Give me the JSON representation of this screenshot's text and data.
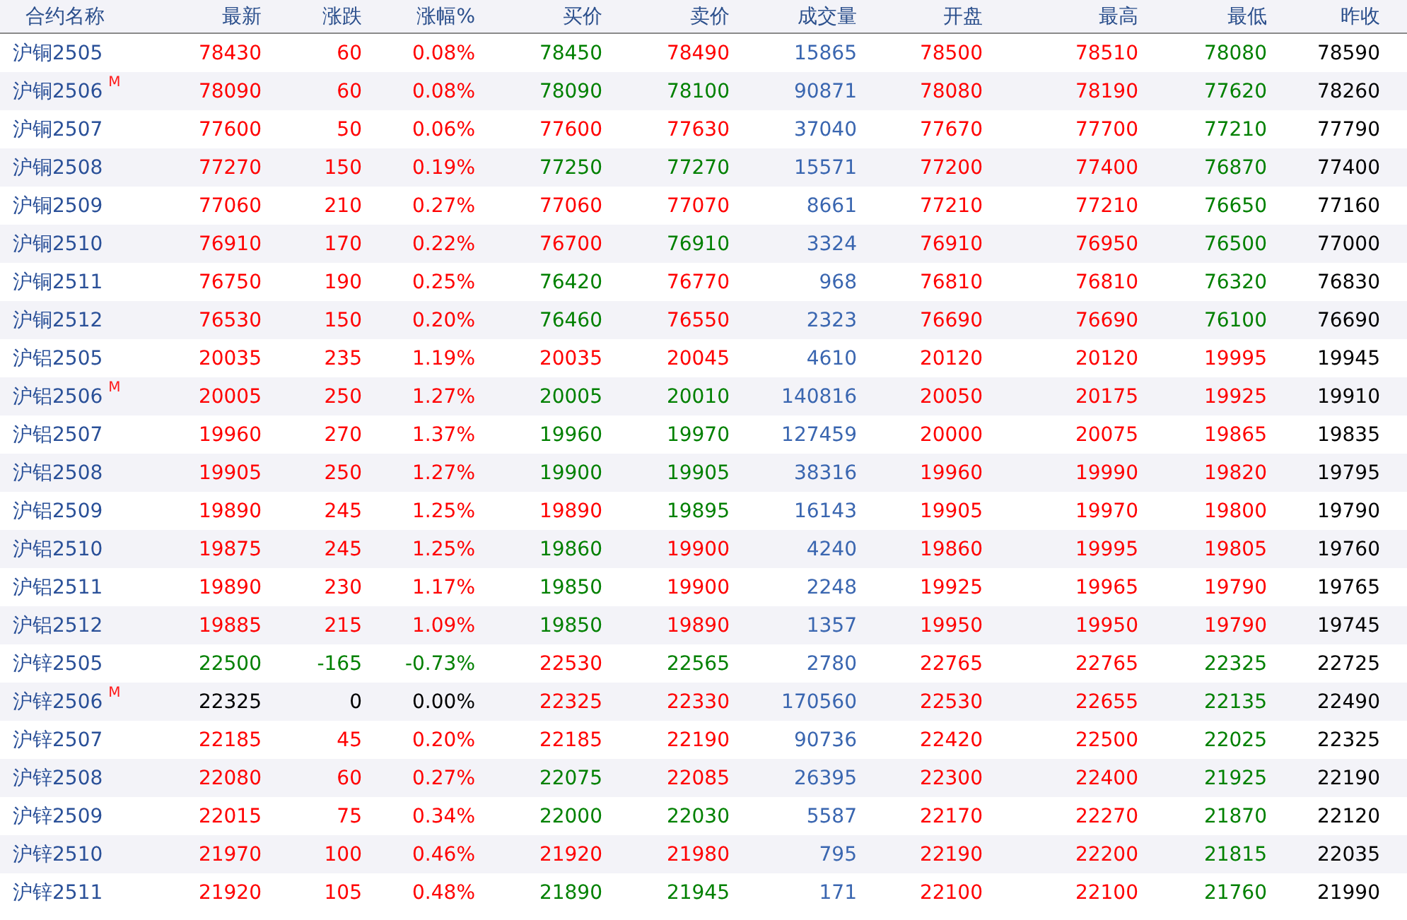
{
  "columns": [
    "合约名称",
    "最新",
    "涨跌",
    "涨幅%",
    "买价",
    "卖价",
    "成交量",
    "开盘",
    "最高",
    "最低",
    "昨收"
  ],
  "rows": [
    {
      "name": "沪铜2505",
      "quote": [
        {
          "text": "78430",
          "color": "#ff0000"
        },
        {
          "text": "60",
          "color": "#ff0000"
        },
        {
          "text": "0.08%",
          "color": "#ff0000"
        },
        {
          "text": "78450",
          "color": "#008000"
        },
        {
          "text": "78490",
          "color": "#ff0000"
        }
      ],
      "volume": "15865",
      "range": [
        {
          "text": "78500",
          "color": "#ff0000"
        },
        {
          "text": "78510",
          "color": "#ff0000"
        },
        {
          "text": "78080",
          "color": "#008000"
        }
      ],
      "prev_close": "78590"
    },
    {
      "name": "沪铜2506",
      "badge": "M",
      "quote": [
        {
          "text": "78090",
          "color": "#ff0000"
        },
        {
          "text": "60",
          "color": "#ff0000"
        },
        {
          "text": "0.08%",
          "color": "#ff0000"
        },
        {
          "text": "78090",
          "color": "#008000"
        },
        {
          "text": "78100",
          "color": "#008000"
        }
      ],
      "volume": "90871",
      "range": [
        {
          "text": "78080",
          "color": "#ff0000"
        },
        {
          "text": "78190",
          "color": "#ff0000"
        },
        {
          "text": "77620",
          "color": "#008000"
        }
      ],
      "prev_close": "78260"
    },
    {
      "name": "沪铜2507",
      "quote": [
        {
          "text": "77600",
          "color": "#ff0000"
        },
        {
          "text": "50",
          "color": "#ff0000"
        },
        {
          "text": "0.06%",
          "color": "#ff0000"
        },
        {
          "text": "77600",
          "color": "#ff0000"
        },
        {
          "text": "77630",
          "color": "#ff0000"
        }
      ],
      "volume": "37040",
      "range": [
        {
          "text": "77670",
          "color": "#ff0000"
        },
        {
          "text": "77700",
          "color": "#ff0000"
        },
        {
          "text": "77210",
          "color": "#008000"
        }
      ],
      "prev_close": "77790"
    },
    {
      "name": "沪铜2508",
      "quote": [
        {
          "text": "77270",
          "color": "#ff0000"
        },
        {
          "text": "150",
          "color": "#ff0000"
        },
        {
          "text": "0.19%",
          "color": "#ff0000"
        },
        {
          "text": "77250",
          "color": "#008000"
        },
        {
          "text": "77270",
          "color": "#008000"
        }
      ],
      "volume": "15571",
      "range": [
        {
          "text": "77200",
          "color": "#ff0000"
        },
        {
          "text": "77400",
          "color": "#ff0000"
        },
        {
          "text": "76870",
          "color": "#008000"
        }
      ],
      "prev_close": "77400"
    },
    {
      "name": "沪铜2509",
      "quote": [
        {
          "text": "77060",
          "color": "#ff0000"
        },
        {
          "text": "210",
          "color": "#ff0000"
        },
        {
          "text": "0.27%",
          "color": "#ff0000"
        },
        {
          "text": "77060",
          "color": "#ff0000"
        },
        {
          "text": "77070",
          "color": "#ff0000"
        }
      ],
      "volume": "8661",
      "range": [
        {
          "text": "77210",
          "color": "#ff0000"
        },
        {
          "text": "77210",
          "color": "#ff0000"
        },
        {
          "text": "76650",
          "color": "#008000"
        }
      ],
      "prev_close": "77160"
    },
    {
      "name": "沪铜2510",
      "quote": [
        {
          "text": "76910",
          "color": "#ff0000"
        },
        {
          "text": "170",
          "color": "#ff0000"
        },
        {
          "text": "0.22%",
          "color": "#ff0000"
        },
        {
          "text": "76700",
          "color": "#ff0000"
        },
        {
          "text": "76910",
          "color": "#008000"
        }
      ],
      "volume": "3324",
      "range": [
        {
          "text": "76910",
          "color": "#ff0000"
        },
        {
          "text": "76950",
          "color": "#ff0000"
        },
        {
          "text": "76500",
          "color": "#008000"
        }
      ],
      "prev_close": "77000"
    },
    {
      "name": "沪铜2511",
      "quote": [
        {
          "text": "76750",
          "color": "#ff0000"
        },
        {
          "text": "190",
          "color": "#ff0000"
        },
        {
          "text": "0.25%",
          "color": "#ff0000"
        },
        {
          "text": "76420",
          "color": "#008000"
        },
        {
          "text": "76770",
          "color": "#ff0000"
        }
      ],
      "volume": "968",
      "range": [
        {
          "text": "76810",
          "color": "#ff0000"
        },
        {
          "text": "76810",
          "color": "#ff0000"
        },
        {
          "text": "76320",
          "color": "#008000"
        }
      ],
      "prev_close": "76830"
    },
    {
      "name": "沪铜2512",
      "quote": [
        {
          "text": "76530",
          "color": "#ff0000"
        },
        {
          "text": "150",
          "color": "#ff0000"
        },
        {
          "text": "0.20%",
          "color": "#ff0000"
        },
        {
          "text": "76460",
          "color": "#008000"
        },
        {
          "text": "76550",
          "color": "#ff0000"
        }
      ],
      "volume": "2323",
      "range": [
        {
          "text": "76690",
          "color": "#ff0000"
        },
        {
          "text": "76690",
          "color": "#ff0000"
        },
        {
          "text": "76100",
          "color": "#008000"
        }
      ],
      "prev_close": "76690"
    },
    {
      "name": "沪铝2505",
      "quote": [
        {
          "text": "20035",
          "color": "#ff0000"
        },
        {
          "text": "235",
          "color": "#ff0000"
        },
        {
          "text": "1.19%",
          "color": "#ff0000"
        },
        {
          "text": "20035",
          "color": "#ff0000"
        },
        {
          "text": "20045",
          "color": "#ff0000"
        }
      ],
      "volume": "4610",
      "range": [
        {
          "text": "20120",
          "color": "#ff0000"
        },
        {
          "text": "20120",
          "color": "#ff0000"
        },
        {
          "text": "19995",
          "color": "#ff0000"
        }
      ],
      "prev_close": "19945"
    },
    {
      "name": "沪铝2506",
      "badge": "M",
      "quote": [
        {
          "text": "20005",
          "color": "#ff0000"
        },
        {
          "text": "250",
          "color": "#ff0000"
        },
        {
          "text": "1.27%",
          "color": "#ff0000"
        },
        {
          "text": "20005",
          "color": "#008000"
        },
        {
          "text": "20010",
          "color": "#008000"
        }
      ],
      "volume": "140816",
      "range": [
        {
          "text": "20050",
          "color": "#ff0000"
        },
        {
          "text": "20175",
          "color": "#ff0000"
        },
        {
          "text": "19925",
          "color": "#ff0000"
        }
      ],
      "prev_close": "19910"
    },
    {
      "name": "沪铝2507",
      "quote": [
        {
          "text": "19960",
          "color": "#ff0000"
        },
        {
          "text": "270",
          "color": "#ff0000"
        },
        {
          "text": "1.37%",
          "color": "#ff0000"
        },
        {
          "text": "19960",
          "color": "#008000"
        },
        {
          "text": "19970",
          "color": "#008000"
        }
      ],
      "volume": "127459",
      "range": [
        {
          "text": "20000",
          "color": "#ff0000"
        },
        {
          "text": "20075",
          "color": "#ff0000"
        },
        {
          "text": "19865",
          "color": "#ff0000"
        }
      ],
      "prev_close": "19835"
    },
    {
      "name": "沪铝2508",
      "quote": [
        {
          "text": "19905",
          "color": "#ff0000"
        },
        {
          "text": "250",
          "color": "#ff0000"
        },
        {
          "text": "1.27%",
          "color": "#ff0000"
        },
        {
          "text": "19900",
          "color": "#008000"
        },
        {
          "text": "19905",
          "color": "#008000"
        }
      ],
      "volume": "38316",
      "range": [
        {
          "text": "19960",
          "color": "#ff0000"
        },
        {
          "text": "19990",
          "color": "#ff0000"
        },
        {
          "text": "19820",
          "color": "#ff0000"
        }
      ],
      "prev_close": "19795"
    },
    {
      "name": "沪铝2509",
      "quote": [
        {
          "text": "19890",
          "color": "#ff0000"
        },
        {
          "text": "245",
          "color": "#ff0000"
        },
        {
          "text": "1.25%",
          "color": "#ff0000"
        },
        {
          "text": "19890",
          "color": "#ff0000"
        },
        {
          "text": "19895",
          "color": "#008000"
        }
      ],
      "volume": "16143",
      "range": [
        {
          "text": "19905",
          "color": "#ff0000"
        },
        {
          "text": "19970",
          "color": "#ff0000"
        },
        {
          "text": "19800",
          "color": "#ff0000"
        }
      ],
      "prev_close": "19790"
    },
    {
      "name": "沪铝2510",
      "quote": [
        {
          "text": "19875",
          "color": "#ff0000"
        },
        {
          "text": "245",
          "color": "#ff0000"
        },
        {
          "text": "1.25%",
          "color": "#ff0000"
        },
        {
          "text": "19860",
          "color": "#008000"
        },
        {
          "text": "19900",
          "color": "#ff0000"
        }
      ],
      "volume": "4240",
      "range": [
        {
          "text": "19860",
          "color": "#ff0000"
        },
        {
          "text": "19995",
          "color": "#ff0000"
        },
        {
          "text": "19805",
          "color": "#ff0000"
        }
      ],
      "prev_close": "19760"
    },
    {
      "name": "沪铝2511",
      "quote": [
        {
          "text": "19890",
          "color": "#ff0000"
        },
        {
          "text": "230",
          "color": "#ff0000"
        },
        {
          "text": "1.17%",
          "color": "#ff0000"
        },
        {
          "text": "19850",
          "color": "#008000"
        },
        {
          "text": "19900",
          "color": "#ff0000"
        }
      ],
      "volume": "2248",
      "range": [
        {
          "text": "19925",
          "color": "#ff0000"
        },
        {
          "text": "19965",
          "color": "#ff0000"
        },
        {
          "text": "19790",
          "color": "#ff0000"
        }
      ],
      "prev_close": "19765"
    },
    {
      "name": "沪铝2512",
      "quote": [
        {
          "text": "19885",
          "color": "#ff0000"
        },
        {
          "text": "215",
          "color": "#ff0000"
        },
        {
          "text": "1.09%",
          "color": "#ff0000"
        },
        {
          "text": "19850",
          "color": "#008000"
        },
        {
          "text": "19890",
          "color": "#ff0000"
        }
      ],
      "volume": "1357",
      "range": [
        {
          "text": "19950",
          "color": "#ff0000"
        },
        {
          "text": "19950",
          "color": "#ff0000"
        },
        {
          "text": "19790",
          "color": "#ff0000"
        }
      ],
      "prev_close": "19745"
    },
    {
      "name": "沪锌2505",
      "quote": [
        {
          "text": "22500",
          "color": "#008000"
        },
        {
          "text": "-165",
          "color": "#008000"
        },
        {
          "text": "-0.73%",
          "color": "#008000"
        },
        {
          "text": "22530",
          "color": "#ff0000"
        },
        {
          "text": "22565",
          "color": "#008000"
        }
      ],
      "volume": "2780",
      "range": [
        {
          "text": "22765",
          "color": "#ff0000"
        },
        {
          "text": "22765",
          "color": "#ff0000"
        },
        {
          "text": "22325",
          "color": "#008000"
        }
      ],
      "prev_close": "22725"
    },
    {
      "name": "沪锌2506",
      "badge": "M",
      "quote": [
        {
          "text": "22325",
          "color": "#000000"
        },
        {
          "text": "0",
          "color": "#000000"
        },
        {
          "text": "0.00%",
          "color": "#000000"
        },
        {
          "text": "22325",
          "color": "#ff0000"
        },
        {
          "text": "22330",
          "color": "#ff0000"
        }
      ],
      "volume": "170560",
      "range": [
        {
          "text": "22530",
          "color": "#ff0000"
        },
        {
          "text": "22655",
          "color": "#ff0000"
        },
        {
          "text": "22135",
          "color": "#008000"
        }
      ],
      "prev_close": "22490"
    },
    {
      "name": "沪锌2507",
      "quote": [
        {
          "text": "22185",
          "color": "#ff0000"
        },
        {
          "text": "45",
          "color": "#ff0000"
        },
        {
          "text": "0.20%",
          "color": "#ff0000"
        },
        {
          "text": "22185",
          "color": "#ff0000"
        },
        {
          "text": "22190",
          "color": "#ff0000"
        }
      ],
      "volume": "90736",
      "range": [
        {
          "text": "22420",
          "color": "#ff0000"
        },
        {
          "text": "22500",
          "color": "#ff0000"
        },
        {
          "text": "22025",
          "color": "#008000"
        }
      ],
      "prev_close": "22325"
    },
    {
      "name": "沪锌2508",
      "quote": [
        {
          "text": "22080",
          "color": "#ff0000"
        },
        {
          "text": "60",
          "color": "#ff0000"
        },
        {
          "text": "0.27%",
          "color": "#ff0000"
        },
        {
          "text": "22075",
          "color": "#008000"
        },
        {
          "text": "22085",
          "color": "#ff0000"
        }
      ],
      "volume": "26395",
      "range": [
        {
          "text": "22300",
          "color": "#ff0000"
        },
        {
          "text": "22400",
          "color": "#ff0000"
        },
        {
          "text": "21925",
          "color": "#008000"
        }
      ],
      "prev_close": "22190"
    },
    {
      "name": "沪锌2509",
      "quote": [
        {
          "text": "22015",
          "color": "#ff0000"
        },
        {
          "text": "75",
          "color": "#ff0000"
        },
        {
          "text": "0.34%",
          "color": "#ff0000"
        },
        {
          "text": "22000",
          "color": "#008000"
        },
        {
          "text": "22030",
          "color": "#008000"
        }
      ],
      "volume": "5587",
      "range": [
        {
          "text": "22170",
          "color": "#ff0000"
        },
        {
          "text": "22270",
          "color": "#ff0000"
        },
        {
          "text": "21870",
          "color": "#008000"
        }
      ],
      "prev_close": "22120"
    },
    {
      "name": "沪锌2510",
      "quote": [
        {
          "text": "21970",
          "color": "#ff0000"
        },
        {
          "text": "100",
          "color": "#ff0000"
        },
        {
          "text": "0.46%",
          "color": "#ff0000"
        },
        {
          "text": "21920",
          "color": "#ff0000"
        },
        {
          "text": "21980",
          "color": "#ff0000"
        }
      ],
      "volume": "795",
      "range": [
        {
          "text": "22190",
          "color": "#ff0000"
        },
        {
          "text": "22200",
          "color": "#ff0000"
        },
        {
          "text": "21815",
          "color": "#008000"
        }
      ],
      "prev_close": "22035"
    },
    {
      "name": "沪锌2511",
      "quote": [
        {
          "text": "21920",
          "color": "#ff0000"
        },
        {
          "text": "105",
          "color": "#ff0000"
        },
        {
          "text": "0.48%",
          "color": "#ff0000"
        },
        {
          "text": "21890",
          "color": "#008000"
        },
        {
          "text": "21945",
          "color": "#008000"
        }
      ],
      "volume": "171",
      "range": [
        {
          "text": "22100",
          "color": "#ff0000"
        },
        {
          "text": "22100",
          "color": "#ff0000"
        },
        {
          "text": "21760",
          "color": "#008000"
        }
      ],
      "prev_close": "21990"
    }
  ]
}
